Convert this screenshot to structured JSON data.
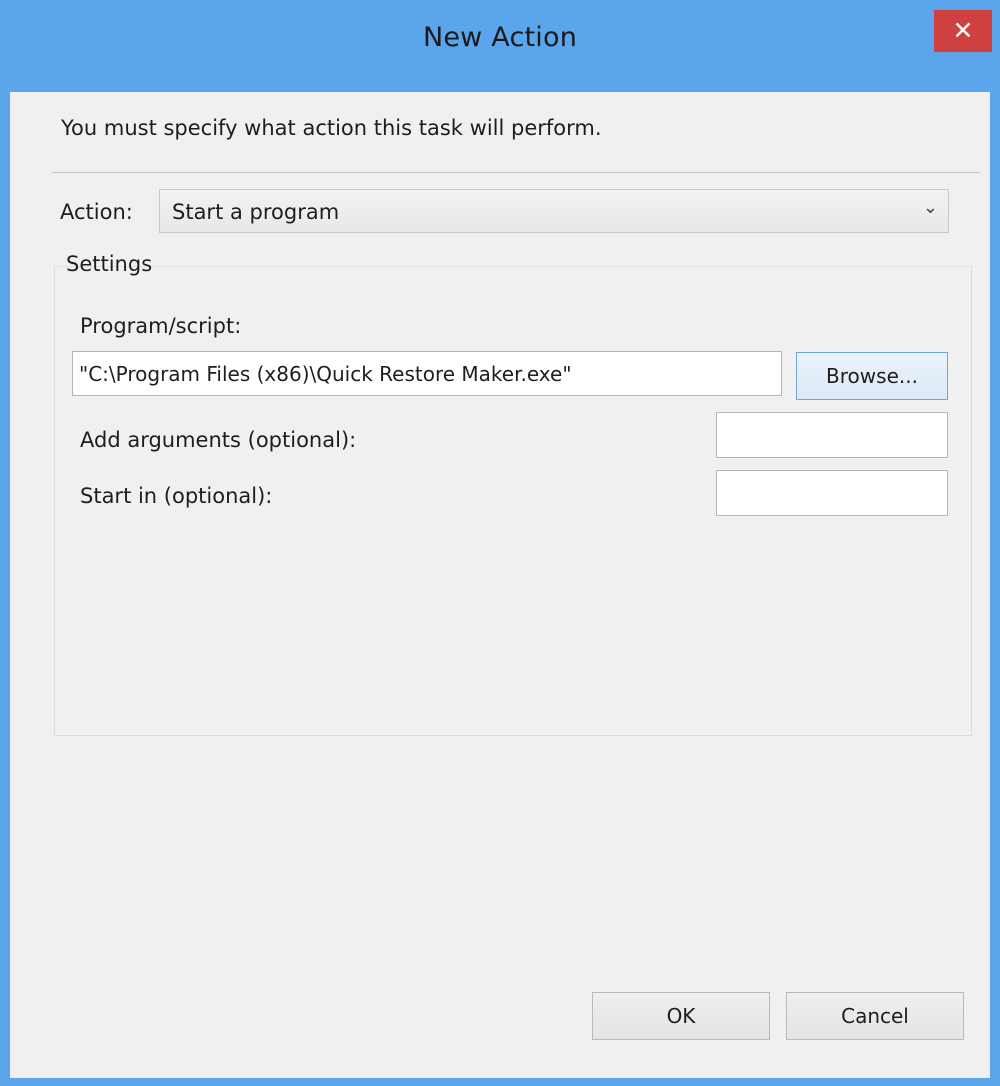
{
  "window": {
    "title": "New Action",
    "close_glyph": "✕",
    "accent_color": "#5aa5ec",
    "close_color": "#cf4141"
  },
  "dialog": {
    "instruction": "You must specify what action this task will perform.",
    "action_label": "Action:",
    "action_value": "Start a program",
    "dropdown_glyph": "⌄",
    "settings_label": "Settings",
    "program_label": "Program/script:",
    "program_value": "\"C:\\Program Files (x86)\\Quick Restore Maker.exe\"",
    "browse_label": "Browse...",
    "args_label": "Add arguments (optional):",
    "args_value": "",
    "startin_label": "Start in (optional):",
    "startin_value": ""
  },
  "footer": {
    "ok_label": "OK",
    "cancel_label": "Cancel"
  }
}
